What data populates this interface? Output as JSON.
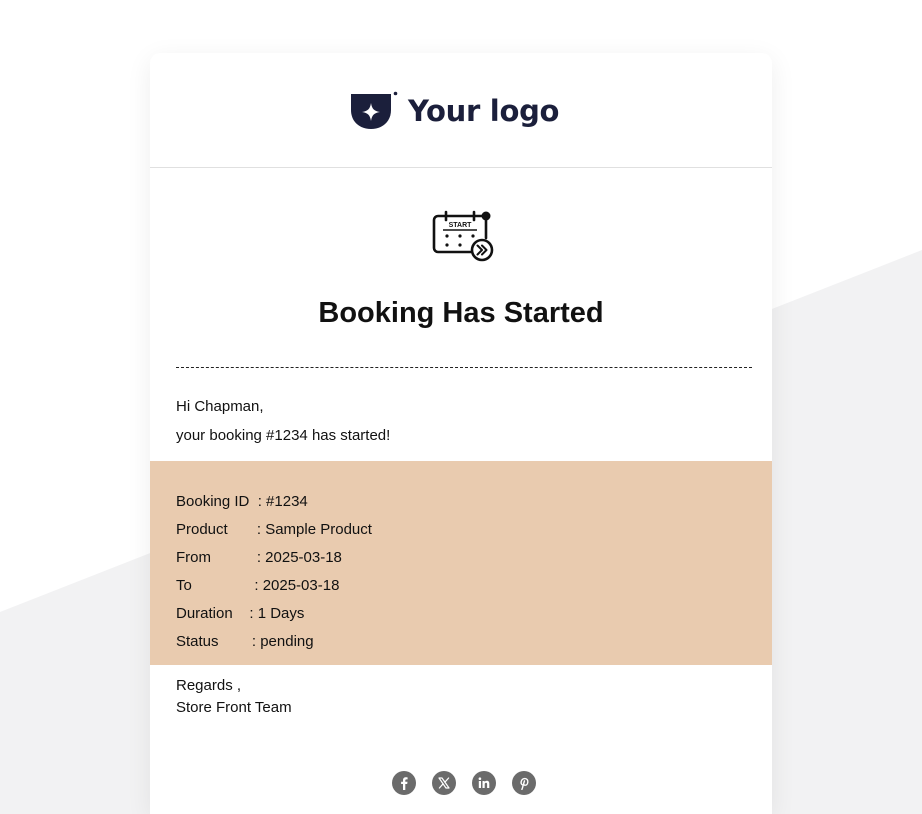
{
  "logo": {
    "text": "Your logo",
    "icon": "shield-star-icon"
  },
  "banner": {
    "icon": "calendar-start-icon",
    "icon_text": "START",
    "title": "Booking Has Started"
  },
  "greeting": "Hi Chapman,",
  "message": "your booking #1234 has started!",
  "details": [
    {
      "label": "Booking ID",
      "value": "#1234"
    },
    {
      "label": "Product",
      "value": "Sample Product"
    },
    {
      "label": "From",
      "value": "2025-03-18"
    },
    {
      "label": "To",
      "value": "2025-03-18"
    },
    {
      "label": "Duration",
      "value": "1 Days"
    },
    {
      "label": "Status",
      "value": "pending"
    }
  ],
  "details_text": [
    "Booking ID  : #1234",
    "Product       : Sample Product",
    "From           : 2025-03-18",
    "To               : 2025-03-18",
    "Duration    : 1 Days",
    "Status        : pending"
  ],
  "signoff": {
    "regards": "Regards ,",
    "team": "Store Front Team"
  },
  "social": [
    {
      "name": "facebook",
      "icon": "facebook-icon"
    },
    {
      "name": "x",
      "icon": "x-twitter-icon"
    },
    {
      "name": "linkedin",
      "icon": "linkedin-icon"
    },
    {
      "name": "pinterest",
      "icon": "pinterest-icon"
    }
  ],
  "colors": {
    "details_background": "#e9cbaf",
    "logo_color": "#1b1f3b",
    "social_icon": "#6b6b6b",
    "page_background_shape": "#f2f2f3"
  }
}
